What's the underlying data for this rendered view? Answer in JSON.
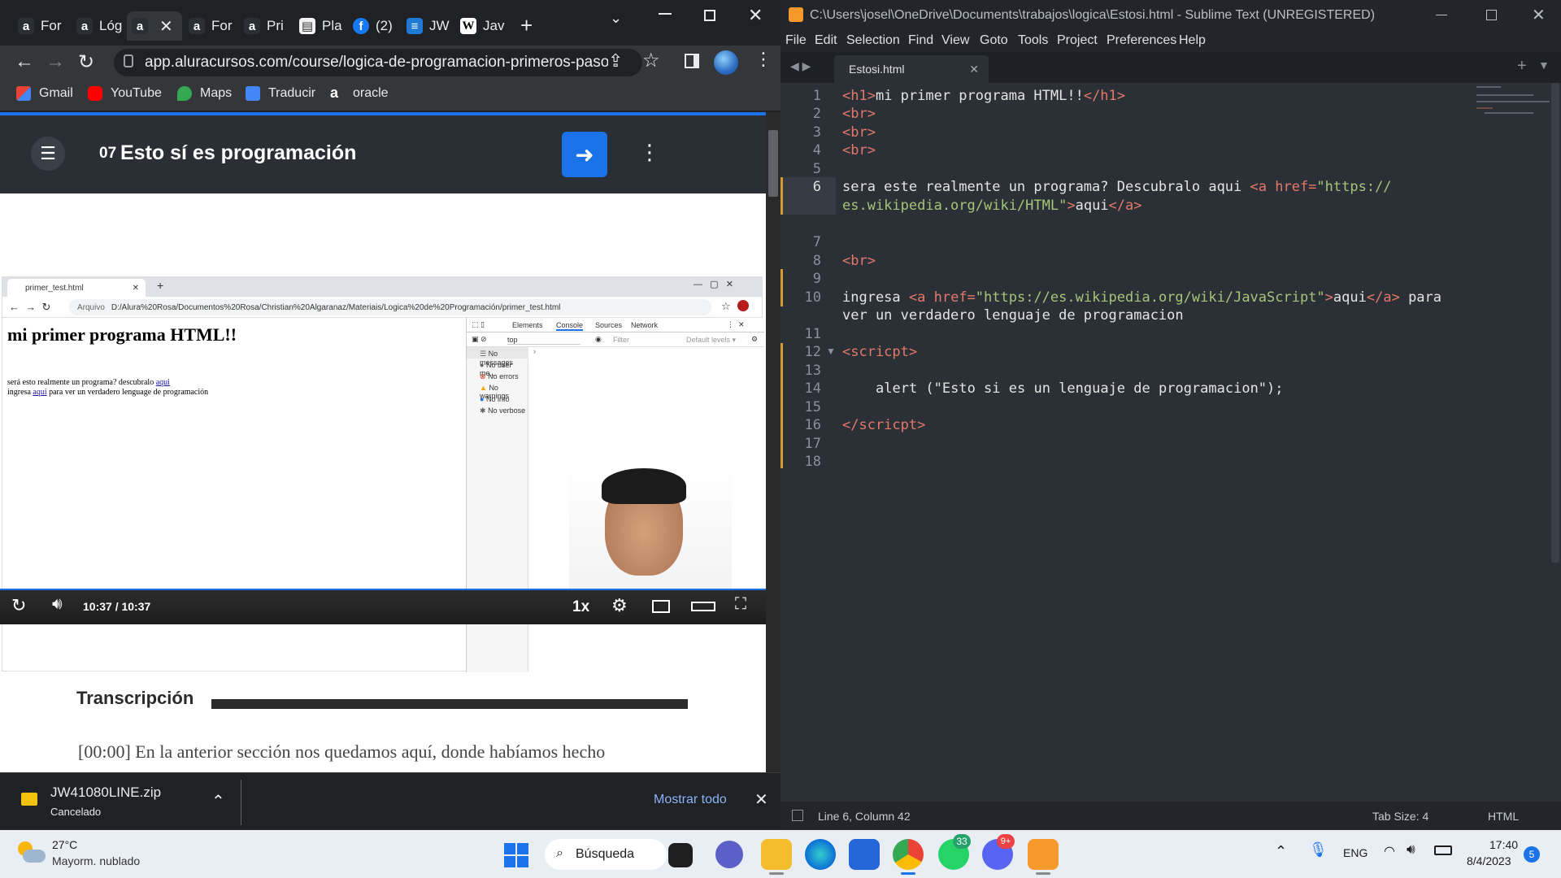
{
  "chrome": {
    "tabs": [
      {
        "icon": "a",
        "label": "For",
        "color": "#2a2f36"
      },
      {
        "icon": "a",
        "label": "Lóg",
        "color": "#2a2f36"
      },
      {
        "icon": "a",
        "label": "",
        "color": "#2a2f36"
      },
      {
        "icon": "a",
        "label": "For",
        "color": "#2a2f36"
      },
      {
        "icon": "a",
        "label": "Pri",
        "color": "#2a2f36"
      },
      {
        "icon": "▤",
        "label": "Pla",
        "color": "#f2f2f2"
      },
      {
        "icon": "f",
        "label": "(2)",
        "color": "#1877f2"
      },
      {
        "icon": "≡",
        "label": "JW",
        "color": "#1f7ad6"
      },
      {
        "icon": "W",
        "label": "Jav",
        "color": "#ffffff"
      }
    ],
    "url": "app.aluracursos.com/course/logica-de-programacion-primeros-pasos/...",
    "bookmarks": [
      {
        "label": "Gmail",
        "color": "#ea4335"
      },
      {
        "label": "YouTube",
        "color": "#ff0000"
      },
      {
        "label": "Maps",
        "color": "#34a853"
      },
      {
        "label": "Traducir",
        "color": "#4285f4"
      },
      {
        "label": "oracle",
        "color": "#ffffff"
      }
    ]
  },
  "lesson": {
    "number": "07",
    "title": "Esto sí es programación"
  },
  "inner_browser": {
    "tab": "primer_test.html",
    "url_prefix": "Arquivo",
    "url": "D:/Alura%20Rosa/Documentos%20Rosa/Christian%20Algaranaz/Materiais/Logica%20de%20Programación/primer_test.html",
    "h1": "mi primer programa HTML!!",
    "line1_text": "será esto realmente un programa? descubralo",
    "line1_link": "aqui",
    "line2_pre": "ingresa",
    "line2_link": "aqui",
    "line2_post": "para ver un verdadero lenguage de programación"
  },
  "devtools": {
    "tabs": [
      "Elements",
      "Console",
      "Sources",
      "Network"
    ],
    "context": "top",
    "filter_placeholder": "Filter",
    "levels": "Default levels ▾",
    "items": [
      "No messages",
      "No user me...",
      "No errors",
      "No warnings",
      "No info",
      "No verbose"
    ],
    "item_colors": [
      "#606060",
      "#606060",
      "#d93025",
      "#f2a600",
      "#1a73e8",
      "#606060"
    ]
  },
  "video": {
    "time_current": "10:37",
    "time_sep": "/",
    "time_total": "10:37",
    "speed": "1x"
  },
  "transcript": {
    "heading": "Transcripción",
    "text": "[00:00] En la anterior sección nos quedamos aquí, donde habíamos hecho"
  },
  "download": {
    "file": "JW41080LINE.zip",
    "status": "Cancelado",
    "show_all": "Mostrar todo"
  },
  "sublime": {
    "title": "C:\\Users\\josel\\OneDrive\\Documents\\trabajos\\logica\\Estosi.html - Sublime Text (UNREGISTERED)",
    "menu": [
      "File",
      "Edit",
      "Selection",
      "Find",
      "View",
      "Goto",
      "Tools",
      "Project",
      "Preferences",
      "Help"
    ],
    "tab": "Estosi.html",
    "status_left": "Line 6, Column 42",
    "tab_size": "Tab Size: 4",
    "syntax": "HTML"
  },
  "code_lines": [
    "1",
    "2",
    "3",
    "4",
    "5",
    "6",
    "",
    "7",
    "8",
    "9",
    "10",
    "",
    "11",
    "12",
    "13",
    "14",
    "15",
    "16",
    "17",
    "18"
  ],
  "code": {
    "l1_t1": "<h1>",
    "l1_txt": "mi primer programa HTML!!",
    "l1_t2": "</h1>",
    "br": "<br>",
    "l6_txt": "sera este realmente un programa? Descubralo aqui ",
    "l6_tag": "<a ",
    "l6_attr": "href=",
    "l6_str1": "\"https://",
    "l6_str2": "es.wikipedia.org/wiki/HTML\"",
    "l6_end": ">",
    "l6_link": "aqui",
    "l6_close": "</a>",
    "l10_txt": "ingresa ",
    "l10_tag": "<a ",
    "l10_attr": "href=",
    "l10_str": "\"https://es.wikipedia.org/wiki/JavaScript\"",
    "l10_end": ">",
    "l10_link": "aqui",
    "l10_close": "</a>",
    "l10_post": " para",
    "l10_cont": "ver un verdadero lenguaje de programacion",
    "l12": "<scricpt>",
    "l14": "alert (\"Esto si es un lenguaje de programacion\");",
    "l16": "</scricpt>"
  },
  "taskbar": {
    "temp": "27°C",
    "weather": "Mayorm. nublado",
    "search": "Búsqueda",
    "lang": "ENG",
    "time": "17:40",
    "date": "8/4/2023",
    "notif": "5",
    "whatsapp_badge": "33",
    "discord_badge": "9+"
  }
}
